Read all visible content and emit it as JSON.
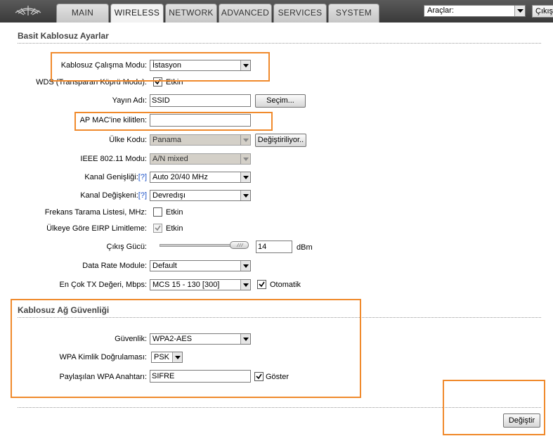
{
  "nav": {
    "tabs": [
      {
        "label": "MAIN"
      },
      {
        "label": "WIRELESS"
      },
      {
        "label": "NETWORK"
      },
      {
        "label": "ADVANCED"
      },
      {
        "label": "SERVICES"
      },
      {
        "label": "SYSTEM"
      }
    ],
    "tools_select": "Araçlar:",
    "logout_label": "Çıkış"
  },
  "basic": {
    "title": "Basit Kablosuz Ayarlar",
    "mode": {
      "label": "Kablosuz Çalışma Modu:",
      "value": "İstasyon"
    },
    "wds": {
      "label": "WDS (Transparan Köprü Modu):",
      "checkbox_label": "Etkin"
    },
    "ssid": {
      "label": "Yayın Adı:",
      "value": "SSID",
      "button": "Seçim..."
    },
    "ap_mac": {
      "label": "AP MAC'ine kilitlen:",
      "value": ""
    },
    "country": {
      "label": "Ülke Kodu:",
      "value": "Panama",
      "button": "Değiştiriliyor.."
    },
    "ieee": {
      "label": "IEEE 802.11 Modu:",
      "value": "A/N mixed"
    },
    "channel_width": {
      "label": "Kanal Genişliği:",
      "help": "[?]",
      "value": "Auto 20/40 MHz"
    },
    "channel_shift": {
      "label": "Kanal Değişkeni:",
      "help": "[?]",
      "value": "Devredışı"
    },
    "freq_scan": {
      "label": "Frekans Tarama Listesi, MHz:",
      "checkbox_label": "Etkin"
    },
    "eirp": {
      "label": "Ülkeye Göre EIRP Limitleme:",
      "checkbox_label": "Etkin"
    },
    "output_power": {
      "label": "Çıkış Gücü:",
      "value": "14",
      "unit": "dBm"
    },
    "data_rate": {
      "label": "Data Rate Module:",
      "value": "Default"
    },
    "max_tx": {
      "label": "En Çok TX Değeri, Mbps:",
      "value": "MCS 15 - 130 [300]",
      "checkbox_label": "Otomatik"
    }
  },
  "security": {
    "title": "Kablosuz Ağ Güvenliği",
    "security": {
      "label": "Güvenlik:",
      "value": "WPA2-AES"
    },
    "auth": {
      "label": "WPA Kimlik Doğrulaması:",
      "value": "PSK"
    },
    "key": {
      "label": "Paylaşılan WPA Anahtarı:",
      "value": "SIFRE",
      "checkbox_label": "Göster"
    }
  },
  "footer": {
    "change_button": "Değiştir"
  },
  "colors": {
    "highlight": "#f08a2c",
    "topbar": "#4a4a4a"
  }
}
